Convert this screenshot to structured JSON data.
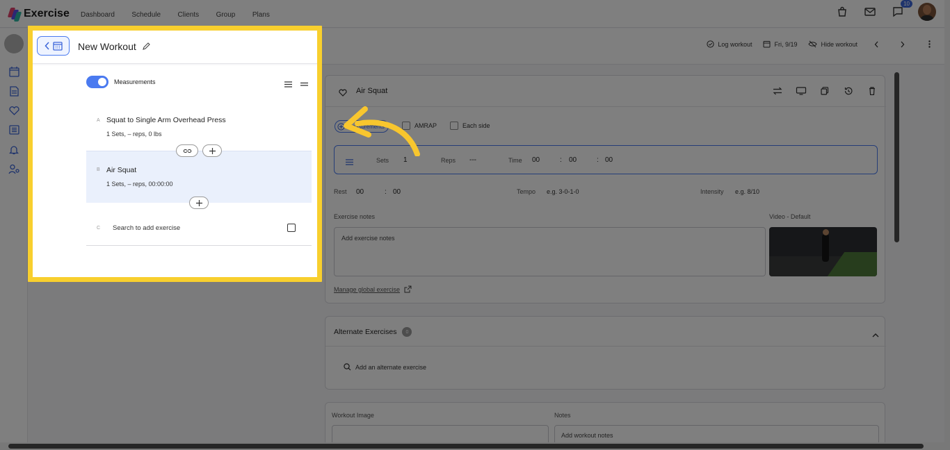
{
  "app": {
    "brand": "Exercise",
    "nav": [
      "Dashboard",
      "Schedule",
      "Clients",
      "Group",
      "Plans"
    ],
    "notification_count": "10"
  },
  "workout": {
    "title": "New Workout",
    "log_workout": "Log workout",
    "date": "Fri, 9/19",
    "hide_workout": "Hide workout"
  },
  "panel": {
    "measurements_label": "Measurements",
    "exercises": [
      {
        "letter": "A",
        "name": "Squat to Single Arm Overhead Press",
        "detail": "1 Sets, – reps, 0 lbs"
      },
      {
        "letter": "B",
        "name": "Air Squat",
        "detail": "1 Sets, – reps, 00:00:00"
      }
    ],
    "search_letter": "C",
    "search_placeholder": "Search to add exercise"
  },
  "exercise_card": {
    "title": "Air Squat",
    "measurements_pill": "Measurements",
    "amrap": "AMRAP",
    "each_side": "Each side",
    "sets_label": "Sets",
    "sets_value": "1",
    "reps_label": "Reps",
    "reps_value": "---",
    "time_label": "Time",
    "time_hh": "00",
    "time_mm": "00",
    "time_ss": "00",
    "rest_label": "Rest",
    "rest_mm": "00",
    "rest_ss": "00",
    "tempo_label": "Tempo",
    "tempo_placeholder": "e.g. 3-0-1-0",
    "intensity_label": "Intensity",
    "intensity_placeholder": "e.g. 8/10",
    "notes_label": "Exercise notes",
    "notes_placeholder": "Add exercise notes",
    "video_label": "Video - Default",
    "manage_link": "Manage global exercise"
  },
  "alternates": {
    "title": "Alternate Exercises",
    "count": "0",
    "add_placeholder": "Add an alternate exercise"
  },
  "bottom": {
    "workout_image_label": "Workout Image",
    "notes_label": "Notes",
    "notes_placeholder": "Add workout notes"
  },
  "colors": {
    "accent": "#4a7af0",
    "highlight": "#f8cf2e",
    "arrow": "#f8c62e"
  }
}
